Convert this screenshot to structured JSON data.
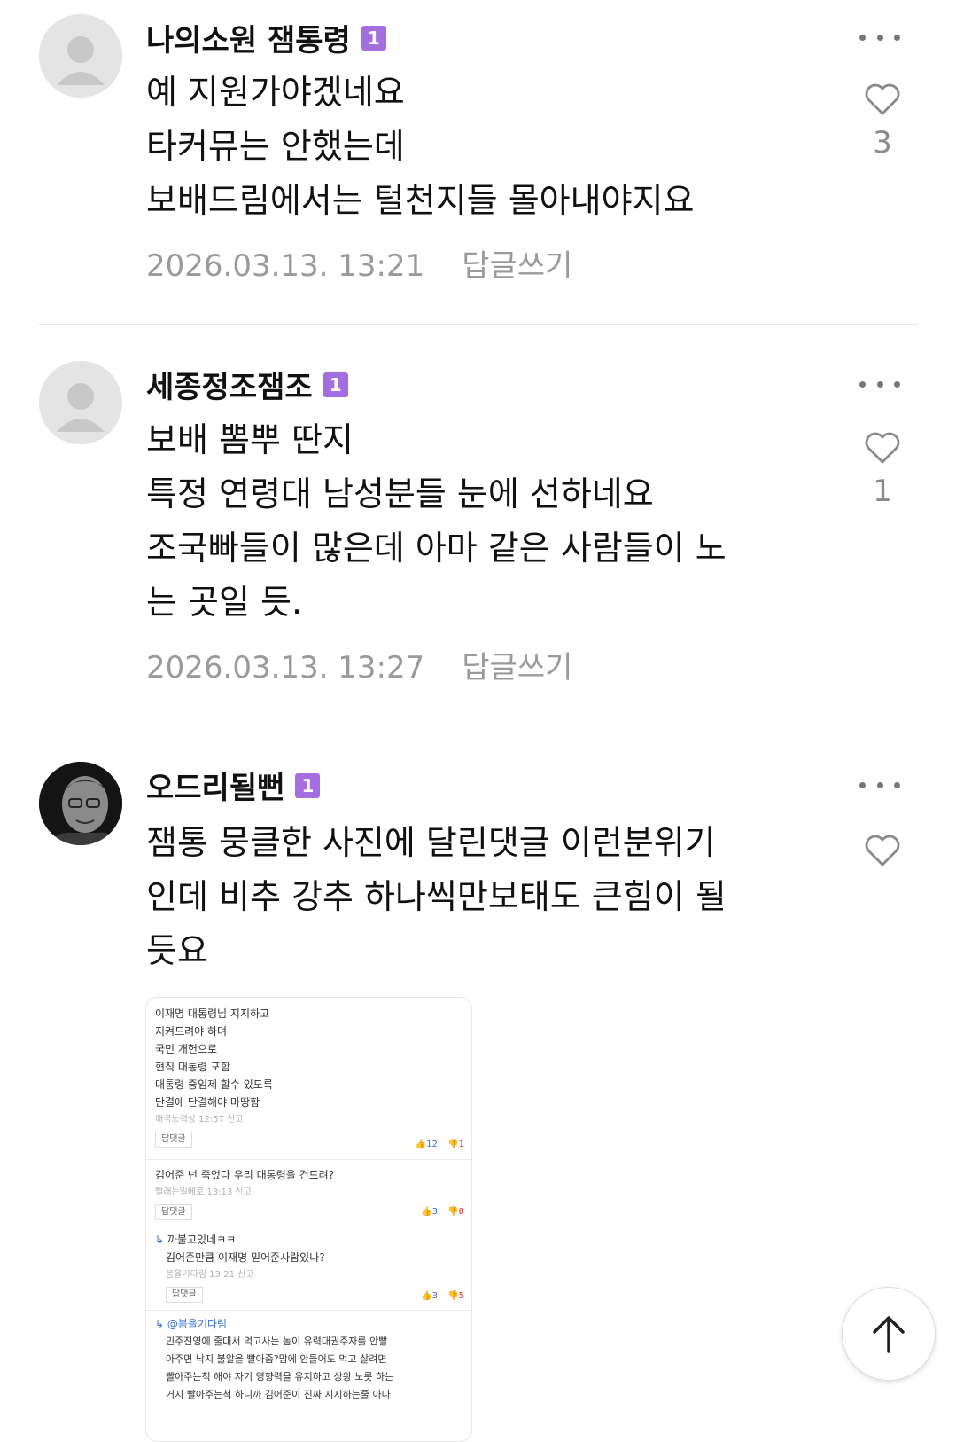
{
  "comments": [
    {
      "nickname": "나의소원 잼통령",
      "level": "1",
      "text": "예 지원가야겠네요\n타커뮤는 안했는데\n보배드림에서는 털천지들 몰아내야지요",
      "date": "2026.03.13. 13:21",
      "reply_label": "답글쓰기",
      "likes": "3"
    },
    {
      "nickname": "세종정조잼조",
      "level": "1",
      "text": "보배 뽐뿌 딴지\n특정 연령대 남성분들 눈에 선하네요\n조국빠들이 많은데 아마 같은 사람들이 노\n는 곳일 듯.",
      "date": "2026.03.13. 13:27",
      "reply_label": "답글쓰기",
      "likes": "1"
    },
    {
      "nickname": "오드리될뻔",
      "level": "1",
      "text": "잼통 뭉클한 사진에 달린댓글 이런분위기\n인데 비추 강추 하나씩만보태도 큰힘이 될\n듯요",
      "likes": ""
    }
  ],
  "embedded": {
    "c1": {
      "lines": [
        "이재명 대통령님 지지하고",
        "지켜드려야 하며",
        "국민 개헌으로",
        "현직 대통령 포함",
        "대통령 중임제 할수 있도록",
        "단결에 단결해야 마땅함"
      ],
      "meta": "애국노력상  12:57  신고",
      "reply": "답댓글",
      "up": "12",
      "down": "1"
    },
    "c2": {
      "lines": [
        "김어준 넌 죽었다 우리 대통령을 건드려?"
      ],
      "meta": "빨래는일베로  13:13  신고",
      "reply": "답댓글",
      "up": "3",
      "down": "8"
    },
    "c3": {
      "lines": [
        "까불고있네ㅋㅋ",
        "김어준만큼 이재명 믿어준사람있나?"
      ],
      "meta": "봄을기다림  13:21  신고",
      "reply": "답댓글",
      "up": "3",
      "down": "5"
    },
    "c4": {
      "mention": "@봄을기다림",
      "lines": [
        "민주진영에 줄대서 먹고사는 놈이 유력대권주자를 안빨",
        "아주면 낙지 불알을 빨아줌?맘에 안들어도 먹고 살려면",
        "빨아주는척 해야 자기 영향력을 유지하고 상왕 노릇 하는",
        "거지 빨아주는척 하니까 김어준이 진짜 지지하는줄 아나"
      ]
    }
  },
  "icons": {
    "more": "more-dots-icon",
    "like": "heart-outline-icon",
    "scroll_top": "arrow-up-icon",
    "level": "level-badge-icon"
  },
  "colors": {
    "level_badge": "#a56ee0",
    "meta_text": "#9a9a9a",
    "link_blue": "#3b6fd6"
  }
}
